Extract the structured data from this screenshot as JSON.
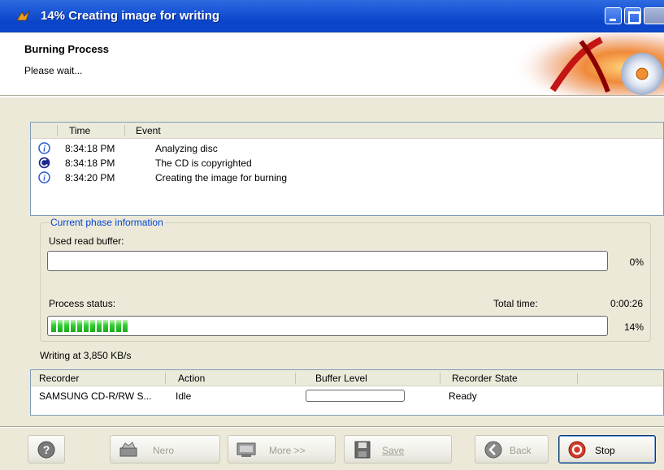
{
  "window": {
    "title": "14% Creating image for writing"
  },
  "header": {
    "title": "Burning Process",
    "subtitle": "Please wait..."
  },
  "log": {
    "columns": [
      "Time",
      "Event"
    ],
    "rows": [
      {
        "icon": "info-icon",
        "time": "8:34:18 PM",
        "event": "Analyzing disc"
      },
      {
        "icon": "copyright-icon",
        "time": "8:34:18 PM",
        "event": "The CD is copyrighted"
      },
      {
        "icon": "info-icon",
        "time": "8:34:20 PM",
        "event": "Creating the image for burning"
      }
    ]
  },
  "phase": {
    "group_label": "Current phase information",
    "read_buffer_label": "Used read buffer:",
    "read_buffer_percent_text": "0%",
    "read_buffer_fraction": 0,
    "process_status_label": "Process status:",
    "total_time_label": "Total time:",
    "total_time": "0:00:26",
    "process_percent_text": "14%",
    "process_fraction": 0.14,
    "writing_speed": "Writing at 3,850 KB/s"
  },
  "recorder": {
    "columns": [
      "Recorder",
      "Action",
      "Buffer Level",
      "Recorder State"
    ],
    "rows": [
      {
        "recorder": "SAMSUNG CD-R/RW S...",
        "action": "Idle",
        "buffer_fraction": 0,
        "state": "Ready"
      }
    ]
  },
  "buttons": {
    "help": "help-icon",
    "nero": "Nero",
    "more": "More >>",
    "save": "Save",
    "back": "Back",
    "stop": "Stop"
  },
  "colors": {
    "title_bar": "#0a44c8",
    "progress": "#2fcf2f",
    "group_label": "#0046d5",
    "stop_icon": "#d23b2b"
  }
}
